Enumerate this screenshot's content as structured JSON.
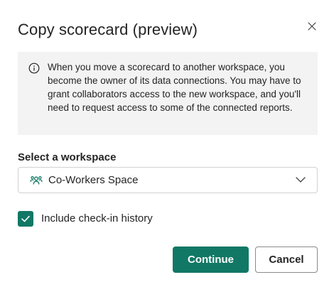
{
  "dialog": {
    "title": "Copy scorecard (preview)",
    "close_icon": "close-icon"
  },
  "info": {
    "icon": "info-icon",
    "text": "When you move a scorecard to another workspace, you become the owner of its data connections. You may have to grant collaborators access to the new workspace, and you'll need to request access to some of the connected reports."
  },
  "workspace": {
    "label": "Select a workspace",
    "selected_value": "Co-Workers Space",
    "icon": "people-workspace-icon"
  },
  "history": {
    "label": "Include check-in history",
    "checked": true
  },
  "actions": {
    "continue_label": "Continue",
    "cancel_label": "Cancel"
  },
  "colors": {
    "accent": "#117865",
    "info_background": "#f3f3f3",
    "text": "#242424",
    "border": "#d1d1d1"
  }
}
